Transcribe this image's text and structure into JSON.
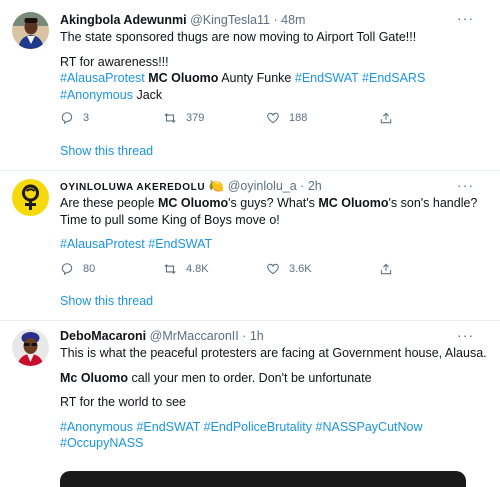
{
  "tweets": [
    {
      "name": "Akingbola Adewunmi",
      "handle": "@KingTesla11",
      "time": "48m",
      "lines": [
        "The state sponsored thugs are now moving to Airport Toll Gate!!!",
        "RT for awareness!!!"
      ],
      "tags_line1": [
        "#AlausaProtest",
        "MC Oluomo",
        "Aunty Funke",
        "#EndSWAT",
        "#EndSARS"
      ],
      "tags_line2": [
        "#Anonymous",
        "Jack"
      ],
      "replies": "3",
      "retweets": "379",
      "likes": "188",
      "show_thread": "Show this thread"
    },
    {
      "name": "OYINLOLUWA AKEREDOLU",
      "emoji": "🍋",
      "handle": "@oyinlolu_a",
      "time": "2h",
      "line1_a": "Are these people ",
      "line1_b": "MC Oluomo",
      "line1_c": "'s guys? What's ",
      "line1_d": "MC Oluomo",
      "line1_e": "'s son's handle?",
      "line2": "Time to pull some King of Boys move o!",
      "tags": [
        "#AlausaProtest",
        "#EndSWAT"
      ],
      "replies": "80",
      "retweets": "4.8K",
      "likes": "3.6K",
      "show_thread": "Show this thread"
    },
    {
      "name": "DeboMacaroni",
      "handle": "@MrMaccaronII",
      "time": "1h",
      "line1": "This is what the peaceful protesters are facing at Government house,  Alausa.",
      "line2_a": "Mc Oluomo",
      "line2_b": " call your men to order. Don't be unfortunate",
      "line3": "RT for the world to see",
      "tags_line1": [
        "#Anonymous",
        "#EndSWAT",
        "#EndPoliceBrutality",
        "#NASSPayCutNow"
      ],
      "tags_line2": [
        "#OccupyNASS"
      ]
    }
  ],
  "separator": "·",
  "more_glyph": "···",
  "icons": [
    "reply-icon",
    "retweet-icon",
    "like-icon",
    "share-icon",
    "more-icon"
  ],
  "colors": {
    "link": "#1b95e0",
    "muted": "#5b7083",
    "text": "#0f1419",
    "border": "#e6ecf0"
  }
}
